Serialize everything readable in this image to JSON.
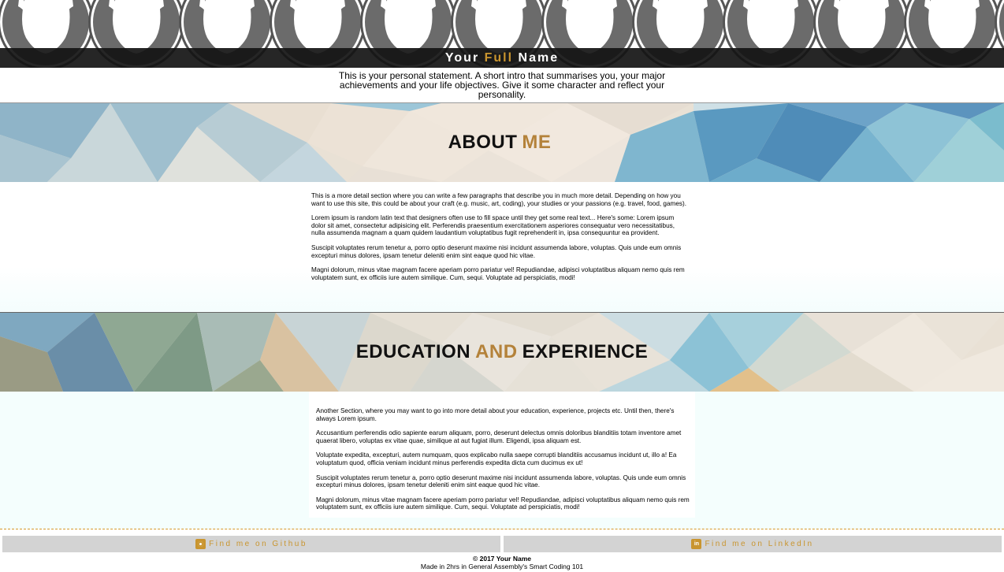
{
  "header": {
    "name_first": "Your",
    "name_accent": "Full",
    "name_last": "Name"
  },
  "statement": "This is your personal statement. A short intro that summarises you, your major achievements and your life objectives. Give it some character and reflect your personality.",
  "about": {
    "title_word": "ABOUT",
    "title_accent": "ME",
    "paragraphs": [
      "This is a more detail section where you can write a few paragraphs that describe you in much more detail. Depending on how you want to use this site, this could be about your craft (e.g. music, art, coding), your studies or your passions (e.g. travel, food, games).",
      "Lorem ipsum is random latin text that designers often use to fill space until they get some real text... Here's some: Lorem ipsum dolor sit amet, consectetur adipisicing elit. Perferendis praesentium exercitationem asperiores consequatur vero necessitatibus, nulla assumenda magnam a quam quidem laudantium voluptatibus fugit reprehenderit in, ipsa consequuntur ea provident.",
      "Suscipit voluptates rerum tenetur a, porro optio deserunt maxime nisi incidunt assumenda labore, voluptas. Quis unde eum omnis excepturi minus dolores, ipsam tenetur deleniti enim sint eaque quod hic vitae.",
      "Magni dolorum, minus vitae magnam facere aperiam porro pariatur vel! Repudiandae, adipisci voluptatibus aliquam nemo quis rem voluptatem sunt, ex officiis iure autem similique. Cum, sequi. Voluptate ad perspiciatis, modi!"
    ]
  },
  "education": {
    "title_word1": "EDUCATION",
    "title_accent": "AND",
    "title_word2": "EXPERIENCE",
    "paragraphs": [
      "Another Section, where you may want to go into more detail about your education, experience, projects etc. Until then, there's always Lorem ipsum.",
      "Accusantium perferendis odio sapiente earum aliquam, porro, deserunt delectus omnis doloribus blanditiis totam inventore amet quaerat libero, voluptas ex vitae quae, similique at aut fugiat illum. Eligendi, ipsa aliquam est.",
      "Voluptate expedita, excepturi, autem numquam, quos explicabo nulla saepe corrupti blanditiis accusamus incidunt ut, illo a! Ea voluptatum quod, officia veniam incidunt minus perferendis expedita dicta cum ducimus ex ut!",
      "Suscipit voluptates rerum tenetur a, porro optio deserunt maxime nisi incidunt assumenda labore, voluptas. Quis unde eum omnis excepturi minus dolores, ipsam tenetur deleniti enim sint eaque quod hic vitae.",
      "Magni dolorum, minus vitae magnam facere aperiam porro pariatur vel! Repudiandae, adipisci voluptatibus aliquam nemo quis rem voluptatem sunt, ex officiis iure autem similique. Cum, sequi. Voluptate ad perspiciatis, modi!"
    ]
  },
  "links": {
    "github_label": "Find me on Github",
    "github_icon": "github-icon",
    "linkedin_label": "Find me on LinkedIn",
    "linkedin_icon": "linkedin-icon",
    "linkedin_glyph": "in"
  },
  "footer": {
    "copyright": "© 2017 Your Name",
    "credit": "Made in 2hrs in General Assembly's Smart Coding 101"
  },
  "colors": {
    "accent": "#c9952f",
    "name_bar": "#141414",
    "link_bg": "#d3d3d3"
  }
}
